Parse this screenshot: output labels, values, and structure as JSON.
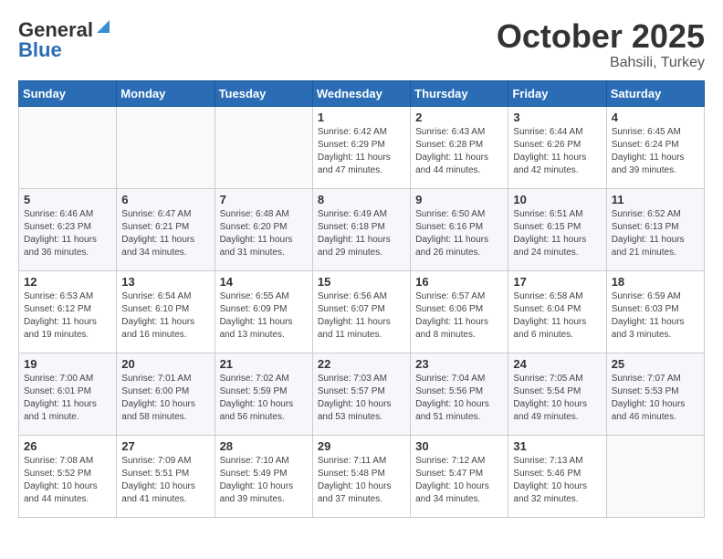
{
  "header": {
    "logo_line1": "General",
    "logo_line2": "Blue",
    "month": "October 2025",
    "location": "Bahsili, Turkey"
  },
  "weekdays": [
    "Sunday",
    "Monday",
    "Tuesday",
    "Wednesday",
    "Thursday",
    "Friday",
    "Saturday"
  ],
  "weeks": [
    [
      {
        "day": "",
        "info": ""
      },
      {
        "day": "",
        "info": ""
      },
      {
        "day": "",
        "info": ""
      },
      {
        "day": "1",
        "info": "Sunrise: 6:42 AM\nSunset: 6:29 PM\nDaylight: 11 hours\nand 47 minutes."
      },
      {
        "day": "2",
        "info": "Sunrise: 6:43 AM\nSunset: 6:28 PM\nDaylight: 11 hours\nand 44 minutes."
      },
      {
        "day": "3",
        "info": "Sunrise: 6:44 AM\nSunset: 6:26 PM\nDaylight: 11 hours\nand 42 minutes."
      },
      {
        "day": "4",
        "info": "Sunrise: 6:45 AM\nSunset: 6:24 PM\nDaylight: 11 hours\nand 39 minutes."
      }
    ],
    [
      {
        "day": "5",
        "info": "Sunrise: 6:46 AM\nSunset: 6:23 PM\nDaylight: 11 hours\nand 36 minutes."
      },
      {
        "day": "6",
        "info": "Sunrise: 6:47 AM\nSunset: 6:21 PM\nDaylight: 11 hours\nand 34 minutes."
      },
      {
        "day": "7",
        "info": "Sunrise: 6:48 AM\nSunset: 6:20 PM\nDaylight: 11 hours\nand 31 minutes."
      },
      {
        "day": "8",
        "info": "Sunrise: 6:49 AM\nSunset: 6:18 PM\nDaylight: 11 hours\nand 29 minutes."
      },
      {
        "day": "9",
        "info": "Sunrise: 6:50 AM\nSunset: 6:16 PM\nDaylight: 11 hours\nand 26 minutes."
      },
      {
        "day": "10",
        "info": "Sunrise: 6:51 AM\nSunset: 6:15 PM\nDaylight: 11 hours\nand 24 minutes."
      },
      {
        "day": "11",
        "info": "Sunrise: 6:52 AM\nSunset: 6:13 PM\nDaylight: 11 hours\nand 21 minutes."
      }
    ],
    [
      {
        "day": "12",
        "info": "Sunrise: 6:53 AM\nSunset: 6:12 PM\nDaylight: 11 hours\nand 19 minutes."
      },
      {
        "day": "13",
        "info": "Sunrise: 6:54 AM\nSunset: 6:10 PM\nDaylight: 11 hours\nand 16 minutes."
      },
      {
        "day": "14",
        "info": "Sunrise: 6:55 AM\nSunset: 6:09 PM\nDaylight: 11 hours\nand 13 minutes."
      },
      {
        "day": "15",
        "info": "Sunrise: 6:56 AM\nSunset: 6:07 PM\nDaylight: 11 hours\nand 11 minutes."
      },
      {
        "day": "16",
        "info": "Sunrise: 6:57 AM\nSunset: 6:06 PM\nDaylight: 11 hours\nand 8 minutes."
      },
      {
        "day": "17",
        "info": "Sunrise: 6:58 AM\nSunset: 6:04 PM\nDaylight: 11 hours\nand 6 minutes."
      },
      {
        "day": "18",
        "info": "Sunrise: 6:59 AM\nSunset: 6:03 PM\nDaylight: 11 hours\nand 3 minutes."
      }
    ],
    [
      {
        "day": "19",
        "info": "Sunrise: 7:00 AM\nSunset: 6:01 PM\nDaylight: 11 hours\nand 1 minute."
      },
      {
        "day": "20",
        "info": "Sunrise: 7:01 AM\nSunset: 6:00 PM\nDaylight: 10 hours\nand 58 minutes."
      },
      {
        "day": "21",
        "info": "Sunrise: 7:02 AM\nSunset: 5:59 PM\nDaylight: 10 hours\nand 56 minutes."
      },
      {
        "day": "22",
        "info": "Sunrise: 7:03 AM\nSunset: 5:57 PM\nDaylight: 10 hours\nand 53 minutes."
      },
      {
        "day": "23",
        "info": "Sunrise: 7:04 AM\nSunset: 5:56 PM\nDaylight: 10 hours\nand 51 minutes."
      },
      {
        "day": "24",
        "info": "Sunrise: 7:05 AM\nSunset: 5:54 PM\nDaylight: 10 hours\nand 49 minutes."
      },
      {
        "day": "25",
        "info": "Sunrise: 7:07 AM\nSunset: 5:53 PM\nDaylight: 10 hours\nand 46 minutes."
      }
    ],
    [
      {
        "day": "26",
        "info": "Sunrise: 7:08 AM\nSunset: 5:52 PM\nDaylight: 10 hours\nand 44 minutes."
      },
      {
        "day": "27",
        "info": "Sunrise: 7:09 AM\nSunset: 5:51 PM\nDaylight: 10 hours\nand 41 minutes."
      },
      {
        "day": "28",
        "info": "Sunrise: 7:10 AM\nSunset: 5:49 PM\nDaylight: 10 hours\nand 39 minutes."
      },
      {
        "day": "29",
        "info": "Sunrise: 7:11 AM\nSunset: 5:48 PM\nDaylight: 10 hours\nand 37 minutes."
      },
      {
        "day": "30",
        "info": "Sunrise: 7:12 AM\nSunset: 5:47 PM\nDaylight: 10 hours\nand 34 minutes."
      },
      {
        "day": "31",
        "info": "Sunrise: 7:13 AM\nSunset: 5:46 PM\nDaylight: 10 hours\nand 32 minutes."
      },
      {
        "day": "",
        "info": ""
      }
    ]
  ]
}
